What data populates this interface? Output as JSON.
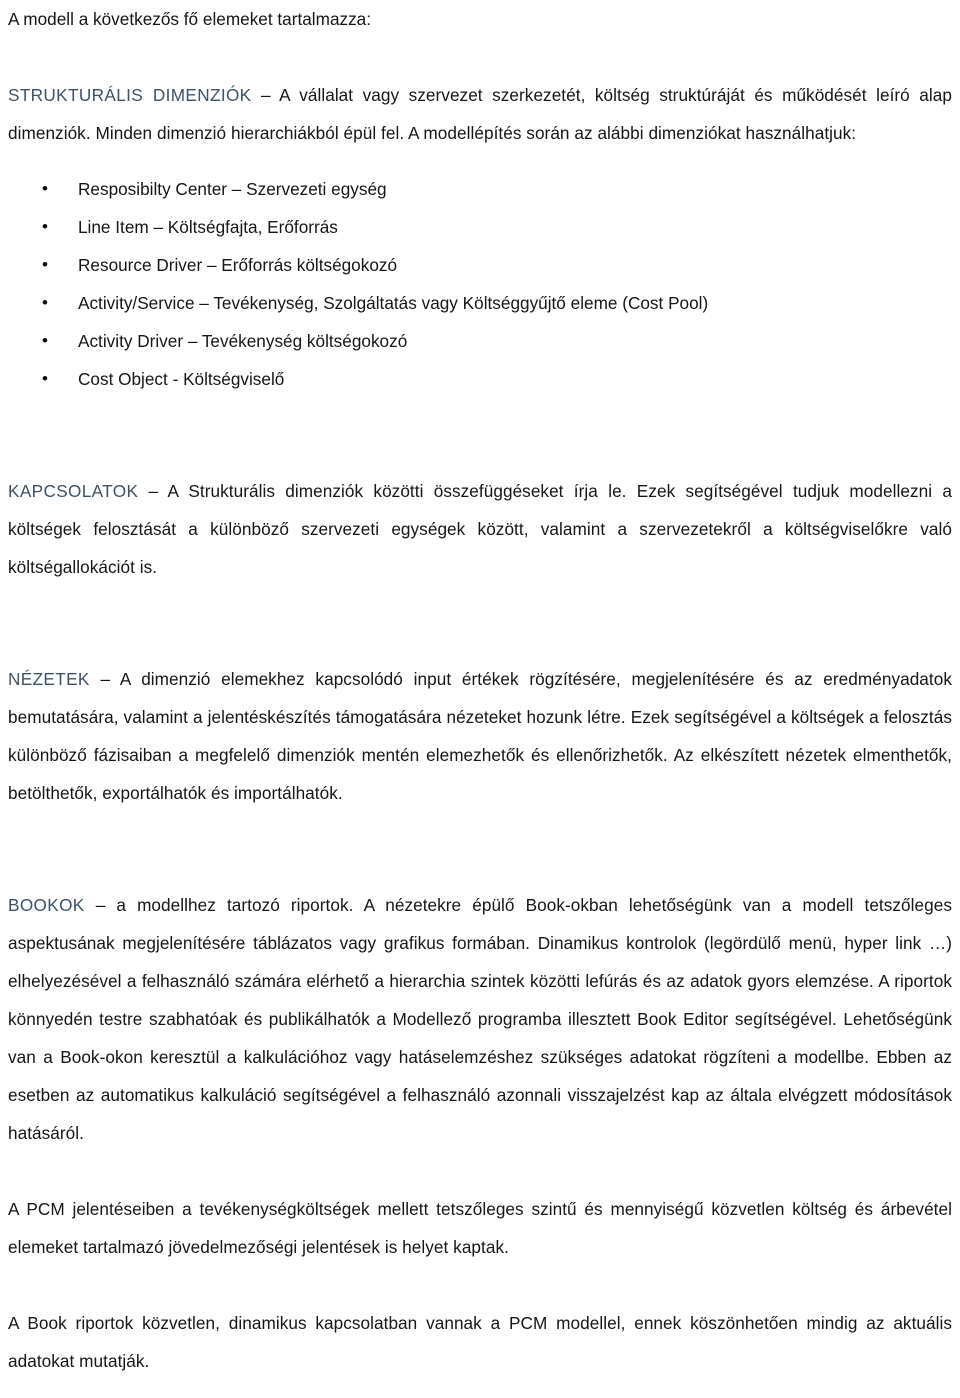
{
  "document": {
    "language": "hu",
    "accent_color": "#3c5368",
    "text_color": "#161616",
    "background_color": "#ffffff",
    "intro_line": "A modell a következős fő elemeket tartalmazza:",
    "sections": [
      {
        "id": "strukturalis-dimenziok",
        "keyword": "STRUKTURÁLIS DIMENZIÓK",
        "body": " – A vállalat vagy szervezet szerkezetét, költség struktúráját és működését leíró alap dimenziók. Minden dimenzió hierarchiákból épül fel. A modellépítés során az alábbi dimenziókat használhatjuk:"
      },
      {
        "id": "kapcsolatok",
        "keyword": "KAPCSOLATOK",
        "body": " – A Strukturális dimenziók közötti összefüggéseket írja le. Ezek segítségével tudjuk modellezni a költségek felosztását a különböző szervezeti egységek között, valamint a szervezetekről a költségviselőkre való költségallokációt is."
      },
      {
        "id": "nezetek",
        "keyword": "NÉZETEK",
        "body": " – A dimenzió elemekhez kapcsolódó input értékek rögzítésére, megjelenítésére és az eredményadatok bemutatására, valamint a jelentéskészítés támogatására nézeteket hozunk létre. Ezek segítségével a költségek a felosztás különböző fázisaiban a megfelelő dimenziók mentén elemezhetők és ellenőrizhetők. Az elkészített nézetek elmenthetők, betölthetők, exportálhatók és importálhatók."
      },
      {
        "id": "bookok",
        "keyword": "BOOKOK",
        "body": " – a modellhez tartozó riportok. A nézetekre épülő Book-okban lehetőségünk van a modell tetszőleges aspektusának megjelenítésére táblázatos vagy grafikus formában. Dinamikus kontrolok (legördülő menü, hyper link …) elhelyezésével a felhasználó számára elérhető a hierarchia szintek közötti lefúrás és az adatok gyors elemzése. A riportok könnyedén testre szabhatóak és publikálhatók a Modellező programba illesztett Book Editor segítségével. Lehetőségünk van a Book-okon keresztül a kalkulációhoz vagy hatáselemzéshez szükséges adatokat rögzíteni a modellbe. Ebben az esetben az automatikus kalkuláció segítségével a felhasználó azonnali visszajelzést kap az általa elvégzett módosítások hatásáról."
      }
    ],
    "dimension_bullets": [
      {
        "marker": "•",
        "text": "Resposibilty Center – Szervezeti egység"
      },
      {
        "marker": "•",
        "text": "Line Item – Költségfajta, Erőforrás"
      },
      {
        "marker": "•",
        "text": "Resource Driver – Erőforrás költségokozó"
      },
      {
        "marker": "•",
        "text": "Activity/Service – Tevékenység, Szolgáltatás vagy Költséggyűjtő eleme (Cost Pool)"
      },
      {
        "marker": "•",
        "text": "Activity Driver – Tevékenység költségokozó"
      },
      {
        "marker": "•",
        "text": "Cost Object - Költségviselő"
      }
    ],
    "closing_paragraphs": [
      "A PCM jelentéseiben a tevékenységköltségek mellett tetszőleges szintű és mennyiségű közvetlen költség és árbevétel elemeket tartalmazó jövedelmezőségi jelentések is helyet kaptak.",
      "A Book riportok közvetlen, dinamikus kapcsolatban vannak a PCM modellel, ennek köszönhetően mindig az aktuális adatokat mutatják."
    ]
  }
}
